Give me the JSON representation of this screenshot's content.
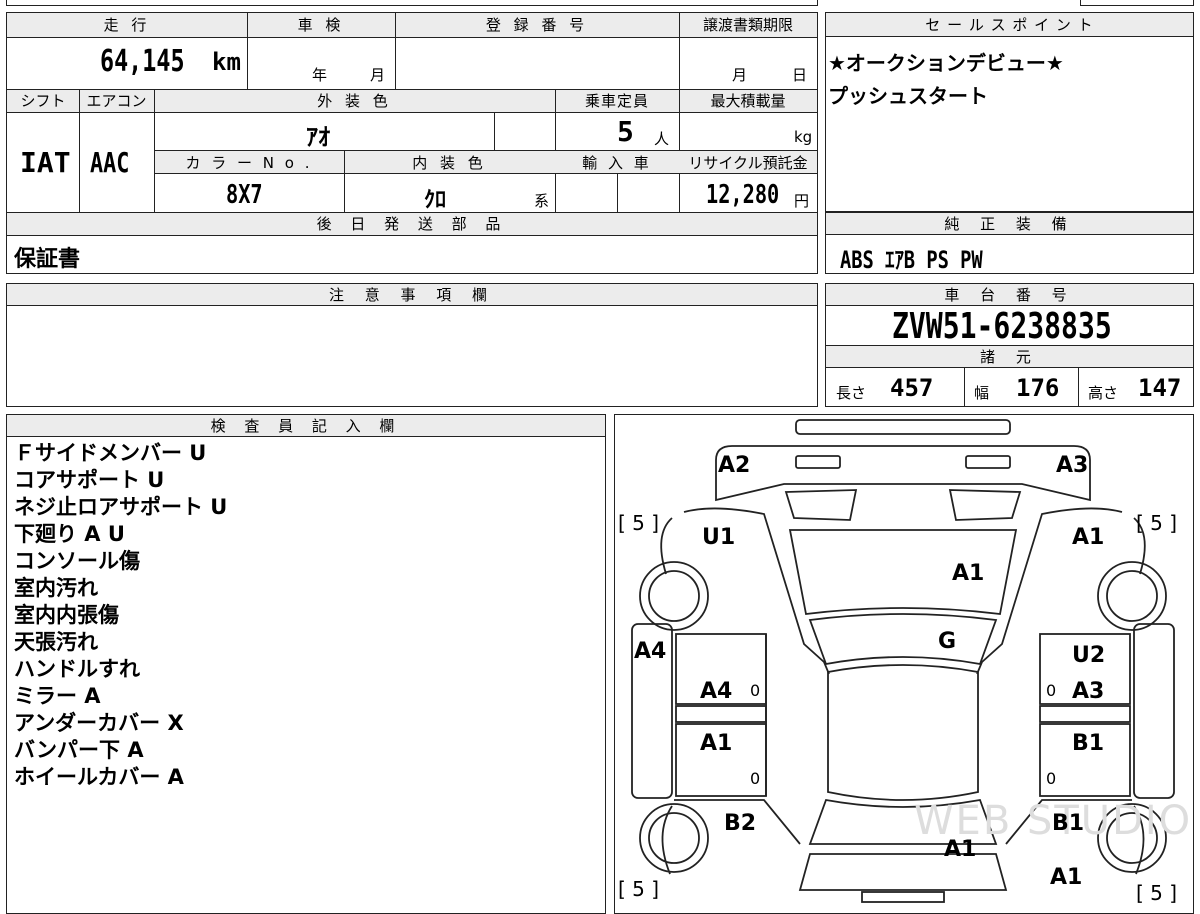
{
  "labels": {
    "mileage": "走 行",
    "shaken": "車 検",
    "registration": "登 録 番 号",
    "transfer_deadline": "譲渡書類期限",
    "shift": "シフト",
    "aircon": "エアコン",
    "exterior_color": "外 装 色",
    "capacity": "乗車定員",
    "max_load": "最大積載量",
    "color_no": "カ ラ ー N o .",
    "interior_color": "内 装 色",
    "import": "輸 入 車",
    "recycle_fee": "リサイクル預託金",
    "later_parts": "後 日 発 送 部 品",
    "sales_points": "セ ー ル ス ポ イ ン ト",
    "oem_equipment": "純 正 装 備",
    "notes": "注 意 事 項 欄",
    "chassis_no": "車 台 番 号",
    "specs": "諸 元",
    "inspector": "検 査 員 記 入 欄"
  },
  "values": {
    "mileage": "64,145",
    "mileage_unit": "km",
    "year_label": "年",
    "month_label": "月",
    "deadline_month": "月",
    "deadline_day": "日",
    "shift": "IAT",
    "aircon": "AAC",
    "exterior_color": "ｱｵ",
    "capacity": "5",
    "capacity_unit": "人",
    "max_load_unit": "kg",
    "color_no": "8X7",
    "interior_color": "ｸﾛ",
    "interior_suffix": "系",
    "recycle_fee": "12,280",
    "recycle_unit": "円",
    "later_parts": "保証書",
    "oem_equipment": "ABS ｴｱB PS PW",
    "chassis_no": "ZVW51-6238835",
    "length_label": "長さ",
    "length": "457",
    "width_label": "幅",
    "width": "176",
    "height_label": "高さ",
    "height": "147"
  },
  "sales_points": [
    "★オークションデビュー★",
    "プッシュスタート"
  ],
  "inspector_notes": [
    "Ｆサイドメンバー U",
    "コアサポート U",
    "ネジ止ロアサポート U",
    "下廻り A U",
    "コンソール傷",
    "室内汚れ",
    "室内内張傷",
    "天張汚れ",
    "ハンドルすれ",
    "ミラー A",
    "アンダーカバー X",
    "バンパー下 A",
    "ホイールカバー A"
  ],
  "diagram": {
    "tire_fl": "[ 5 ]",
    "tire_fr": "[ 5 ]",
    "tire_rl": "[ 5 ]",
    "tire_rr": "[ 5 ]",
    "front_left_corner": "A2",
    "front_right_corner": "A3",
    "front_left_fender": "U1",
    "front_right_fender": "A1",
    "hood": "A1",
    "windshield": "G",
    "left_rocker": "A4",
    "front_left_door": "A4",
    "rear_left_door": "A1",
    "front_right_door_top": "U2",
    "front_right_door": "A3",
    "rear_right_door": "B1",
    "rear_left_quarter": "B2",
    "rear_right_quarter": "B1",
    "trunk": "A1",
    "rear_right_corner": "A1",
    "door_mark": "0",
    "watermark": "WEB STUDIO"
  }
}
